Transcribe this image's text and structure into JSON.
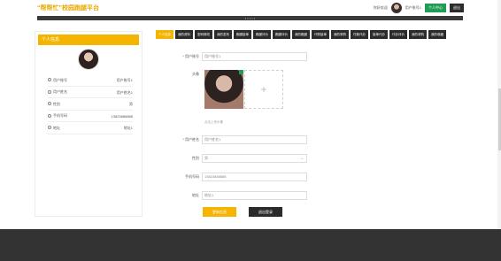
{
  "header": {
    "brand": "“帮帮忙”校园跑腿平台",
    "welcome": "你好欢迎",
    "username": "用户账号1",
    "center_button": "个人中心",
    "logout_button": "退出"
  },
  "sidebar": {
    "title": "个人信息",
    "rows": [
      {
        "label": "用户账号",
        "value": "用户账号1",
        "icon": "user-icon"
      },
      {
        "label": "用户姓名",
        "value": "用户姓名1",
        "icon": "user-icon"
      },
      {
        "label": "性别",
        "value": "男",
        "icon": "gender-icon"
      },
      {
        "label": "手机号码",
        "value": "13823888888",
        "icon": "phone-icon"
      },
      {
        "label": "地址",
        "value": "地址1",
        "icon": "home-icon"
      }
    ]
  },
  "tabs": [
    "个人信息",
    "我的资料",
    "密码修改",
    "我的发布",
    "跑腿接单",
    "跑腿评价",
    "跑腿评价",
    "我的跑腿",
    "代购接单",
    "我的采购",
    "付款代办",
    "接单代办",
    "代办评价",
    "我的求购",
    "我的收藏"
  ],
  "form": {
    "account_label": "用户账号",
    "account_value": "用户账号1",
    "avatar_label": "头像",
    "upload_hint": "点击上传头像",
    "name_label": "用户姓名",
    "name_value": "用户姓名1",
    "gender_label": "性别",
    "gender_value": "男",
    "phone_label": "手机号码",
    "phone_value": "13823888888",
    "address_label": "地址",
    "address_value": "地址1",
    "add_symbol": "+"
  },
  "actions": {
    "save": "更新信息",
    "back": "退出登录"
  }
}
